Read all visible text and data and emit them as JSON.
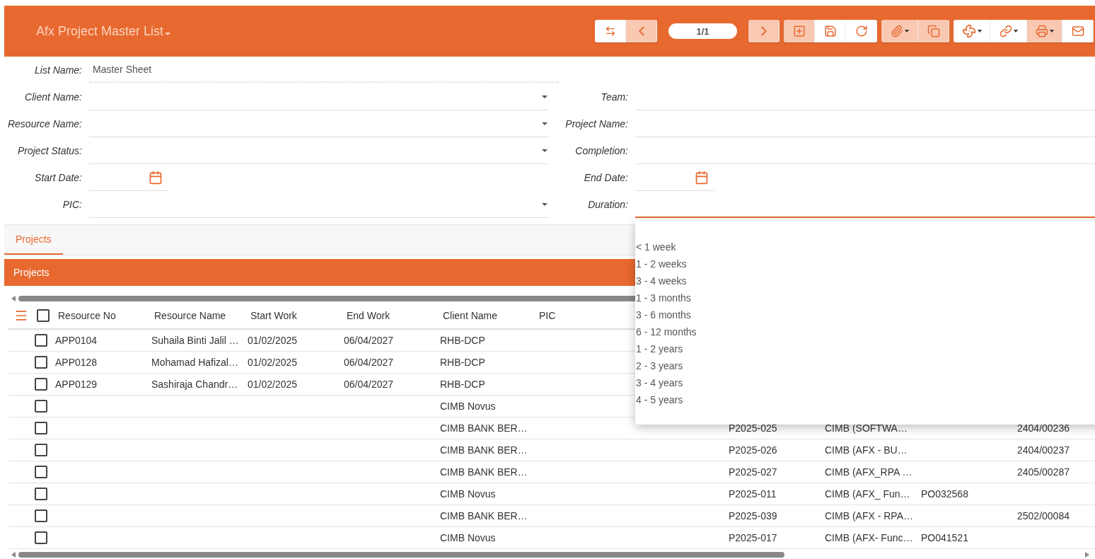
{
  "header": {
    "title": "Afx Project Master List",
    "pager": "1/1"
  },
  "form": {
    "list_name": {
      "label": "List Name:",
      "value": "Master Sheet"
    },
    "left": [
      {
        "label": "Client Name:",
        "kind": "select"
      },
      {
        "label": "Resource Name:",
        "kind": "select"
      },
      {
        "label": "Project Status:",
        "kind": "select"
      },
      {
        "label": "Start Date:",
        "kind": "date"
      },
      {
        "label": "PIC:",
        "kind": "select"
      }
    ],
    "right": [
      {
        "label": "Team:",
        "kind": "text"
      },
      {
        "label": "Project Name:",
        "kind": "text"
      },
      {
        "label": "Completion:",
        "kind": "text"
      },
      {
        "label": "End Date:",
        "kind": "date"
      },
      {
        "label": "Duration:",
        "kind": "text",
        "expanded": true
      }
    ]
  },
  "tabs": [
    {
      "label": "Projects",
      "selected": true
    }
  ],
  "panel": {
    "title": "Projects"
  },
  "table": {
    "select_all_checked": false,
    "columns": [
      "Resource No",
      "Resource Name",
      "Start Work",
      "End Work",
      "Client Name",
      "PIC"
    ],
    "rows": [
      {
        "checked": false,
        "resource_no": "APP0104",
        "resource_name": "Suhaila Binti Jalil …",
        "start_work": "01/02/2025",
        "end_work": "06/04/2027",
        "client_name": "RHB-DCP"
      },
      {
        "checked": false,
        "resource_no": "APP0128",
        "resource_name": "Mohamad Hafizal…",
        "start_work": "01/02/2025",
        "end_work": "06/04/2027",
        "client_name": "RHB-DCP"
      },
      {
        "checked": false,
        "resource_no": "APP0129",
        "resource_name": "Sashiraja Chandr…",
        "start_work": "01/02/2025",
        "end_work": "06/04/2027",
        "client_name": "RHB-DCP"
      },
      {
        "checked": false,
        "client_name": "CIMB Novus"
      },
      {
        "checked": false,
        "client_name": "CIMB BANK BER…",
        "column_8": "P2025-025",
        "column_9": "CIMB (SOFTWA…",
        "column_11": "2404/00236"
      },
      {
        "checked": false,
        "client_name": "CIMB BANK BER…",
        "column_8": "P2025-026",
        "column_9": "CIMB (AFX - BU…",
        "column_11": "2404/00237"
      },
      {
        "checked": false,
        "client_name": "CIMB BANK BER…",
        "column_8": "P2025-027",
        "column_9": "CIMB (AFX_RPA …",
        "column_11": "2405/00287"
      },
      {
        "checked": false,
        "client_name": "CIMB Novus",
        "column_8": "P2025-011",
        "column_9": "CIMB (AFX_ Fun…",
        "column_10": "PO032568"
      },
      {
        "checked": false,
        "client_name": "CIMB BANK BER…",
        "column_8": "P2025-039",
        "column_9": "CIMB (AFX - RPA…",
        "column_11": "2502/00084"
      },
      {
        "checked": false,
        "client_name": "CIMB Novus",
        "column_8": "P2025-017",
        "column_9": "CIMB (AFX- Func…",
        "column_10": "PO041521"
      }
    ]
  },
  "duration_options": [
    "< 1 week",
    "1 - 2 weeks",
    "3 - 4 weeks",
    "1 - 3 months",
    "3 - 6 months",
    "6 - 12 months",
    "1 - 2 years",
    "2 - 3 years",
    "3 - 4 years",
    "4 - 5 years"
  ]
}
